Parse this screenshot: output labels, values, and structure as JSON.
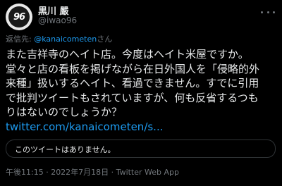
{
  "tweet": {
    "display_name": "黒川 嚴",
    "handle": "@iwao96",
    "avatar_text": "96",
    "reply_prefix": "返信先: ",
    "reply_mention": "@kanaicometen",
    "reply_suffix": "さん",
    "body_lines": [
      "また吉祥寺のヘイト店。今度はヘイト米屋ですか。",
      "堂々と店の看板を掲げながら在日外国人を「侵略的外",
      "来種」扱いするヘイト、看過できません。すでに引用",
      "で批判ツイートもされていますが、何も反省するつも",
      "りはないのでしょうか？"
    ],
    "link_text": "twitter.com/kanaicometen/s...",
    "quote_unavailable": "このツイートはありません。",
    "timestamp": "午後11:15 · 2022年7月18日 · Twitter Web App"
  },
  "colors": {
    "background": "#000000",
    "text": "#e7e9ea",
    "secondary": "#71767b",
    "accent": "#1d9bf0",
    "border": "#2f3336"
  },
  "icons": {
    "more": "more-horizontal-icon"
  }
}
